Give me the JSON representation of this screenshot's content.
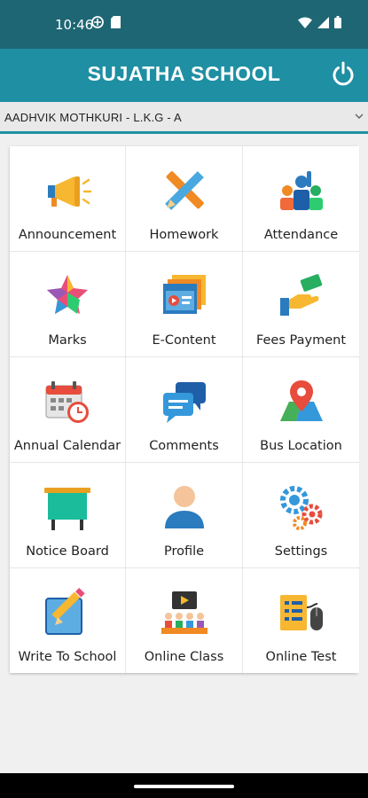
{
  "status_bar": {
    "time": "10:46"
  },
  "app_bar": {
    "title": "SUJATHA SCHOOL"
  },
  "student_selector": {
    "value": "AADHVIK MOTHKURI - L.K.G - A"
  },
  "menu": [
    {
      "label": "Announcement",
      "icon": "megaphone-icon"
    },
    {
      "label": "Homework",
      "icon": "pencil-ruler-icon"
    },
    {
      "label": "Attendance",
      "icon": "attendance-icon"
    },
    {
      "label": "Marks",
      "icon": "star-icon"
    },
    {
      "label": "E-Content",
      "icon": "video-content-icon"
    },
    {
      "label": "Fees Payment",
      "icon": "payment-icon"
    },
    {
      "label": "Annual Calendar",
      "icon": "calendar-clock-icon"
    },
    {
      "label": "Comments",
      "icon": "chat-bubbles-icon"
    },
    {
      "label": "Bus Location",
      "icon": "map-pin-icon"
    },
    {
      "label": "Notice Board",
      "icon": "notice-board-icon"
    },
    {
      "label": "Profile",
      "icon": "profile-icon"
    },
    {
      "label": "Settings",
      "icon": "gears-icon"
    },
    {
      "label": "Write To School",
      "icon": "write-icon"
    },
    {
      "label": "Online Class",
      "icon": "online-class-icon"
    },
    {
      "label": "Online Test",
      "icon": "online-test-icon"
    }
  ],
  "colors": {
    "status_bar": "#1e6674",
    "app_bar": "#1f8fa3",
    "accent": "#1f8fa3"
  }
}
